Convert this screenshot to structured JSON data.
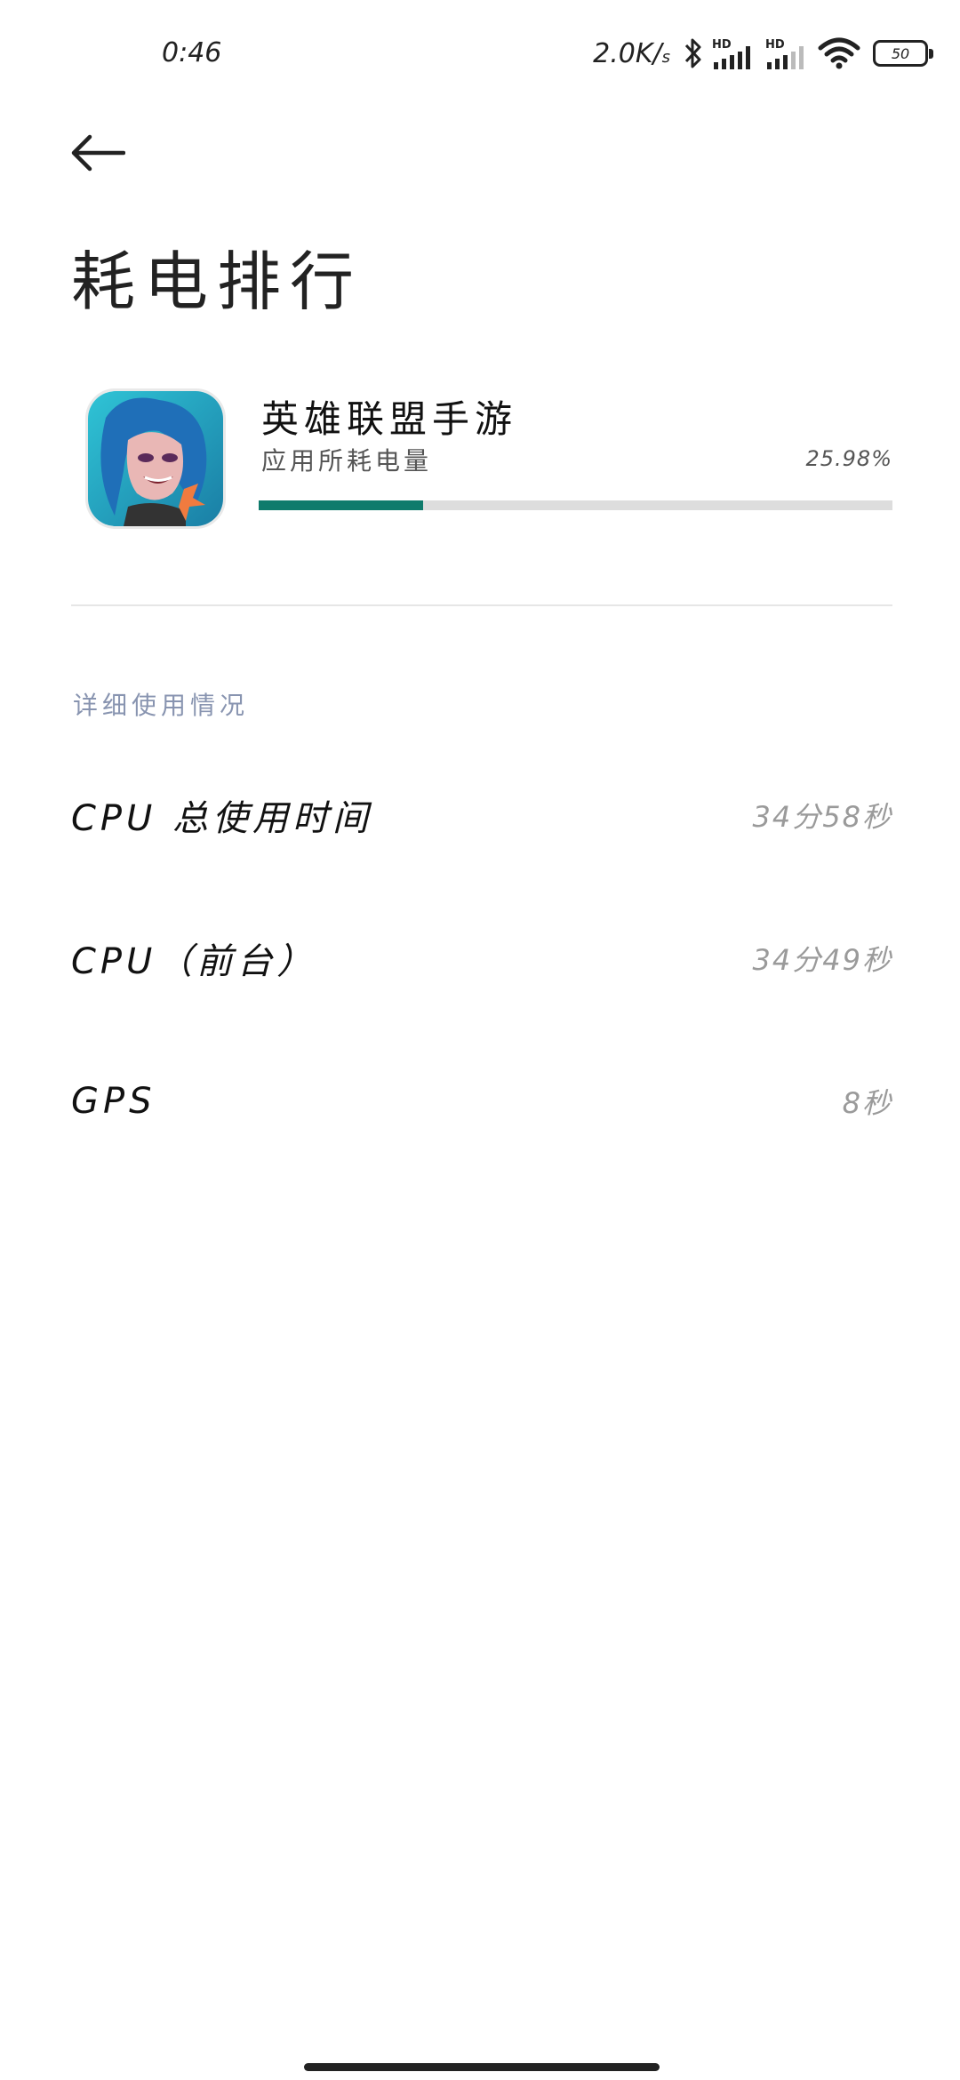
{
  "status_bar": {
    "time": "0:46",
    "net_speed": "2.0K/",
    "net_speed_unit": "s",
    "hd1": "HD",
    "hd2": "HD",
    "battery": "50"
  },
  "page": {
    "title": "耗电排行"
  },
  "app": {
    "name": "英雄联盟手游",
    "subtitle": "应用所耗电量",
    "percent_text": "25.98%",
    "percent_value": 25.98,
    "accent_color": "#0f7b6c"
  },
  "details": {
    "section_label": "详细使用情况",
    "rows": [
      {
        "label": "CPU 总使用时间",
        "value": "34分58秒"
      },
      {
        "label": "CPU（前台）",
        "value": "34分49秒"
      },
      {
        "label": "GPS",
        "value": "8秒"
      }
    ]
  },
  "icons": {
    "back": "arrow-left-icon",
    "bluetooth": "bluetooth-icon",
    "signal": "cell-signal-icon",
    "wifi": "wifi-icon",
    "battery": "battery-icon"
  }
}
